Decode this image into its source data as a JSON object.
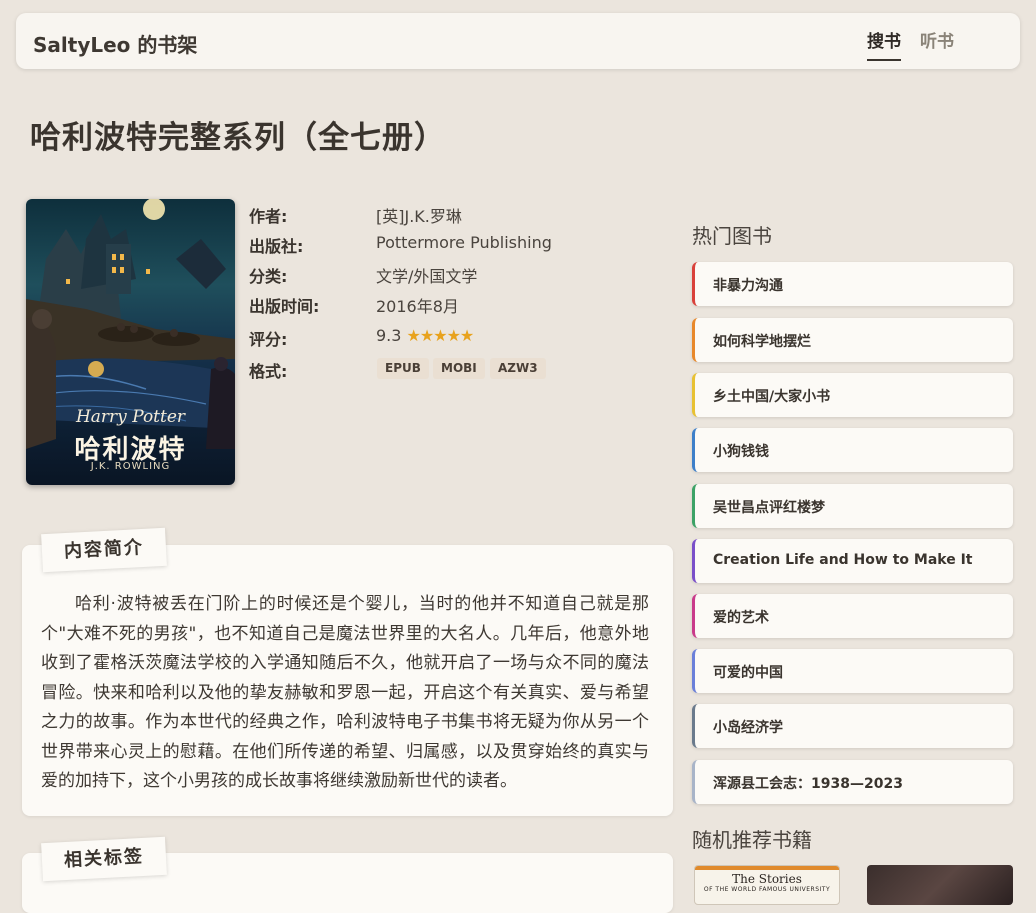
{
  "header": {
    "site_title": "SaltyLeo 的书架",
    "nav": [
      {
        "label": "搜书",
        "active": true
      },
      {
        "label": "听书",
        "active": false
      }
    ]
  },
  "book": {
    "title": "哈利波特完整系列（全七册）",
    "cover": {
      "brand": "Harry Potter",
      "cn_title": "哈利波特",
      "author": "J.K. ROWLING"
    },
    "meta": [
      {
        "label": "作者:",
        "value": "[英]J.K.罗琳"
      },
      {
        "label": "出版社:",
        "value": "Pottermore Publishing"
      },
      {
        "label": "分类:",
        "value": "文学/外国文学"
      },
      {
        "label": "出版时间:",
        "value": "2016年8月"
      },
      {
        "label": "评分:",
        "value": "9.3"
      },
      {
        "label": "格式:",
        "value": ""
      }
    ],
    "rating_stars": "★★★★★",
    "formats": [
      "EPUB",
      "MOBI",
      "AZW3"
    ]
  },
  "intro": {
    "heading": "内容简介",
    "text": "哈利·波特被丢在门阶上的时候还是个婴儿，当时的他并不知道自己就是那个\"大难不死的男孩\"，也不知道自己是魔法世界里的大名人。几年后，他意外地收到了霍格沃茨魔法学校的入学通知随后不久，他就开启了一场与众不同的魔法冒险。快来和哈利以及他的挚友赫敏和罗恩一起，开启这个有关真实、爱与希望之力的故事。作为本世代的经典之作，哈利波特电子书集书将无疑为你从另一个世界带来心灵上的慰藉。在他们所传递的希望、归属感，以及贯穿始终的真实与爱的加持下，这个小男孩的成长故事将继续激励新世代的读者。"
  },
  "tags": {
    "heading": "相关标签"
  },
  "sidebar": {
    "hot_heading": "热门图书",
    "hot_books": [
      {
        "title": "非暴力沟通",
        "color": "#d9413a"
      },
      {
        "title": "如何科学地摆烂",
        "color": "#e8882a"
      },
      {
        "title": "乡土中国/大家小书",
        "color": "#e8c132"
      },
      {
        "title": "小狗钱钱",
        "color": "#3d7fc9"
      },
      {
        "title": "吴世昌点评红楼梦",
        "color": "#3ca266"
      },
      {
        "title": "Creation Life and How to Make It",
        "color": "#7a4fc9"
      },
      {
        "title": "爱的艺术",
        "color": "#c93a8a"
      },
      {
        "title": "可爱的中国",
        "color": "#6a7fd9"
      },
      {
        "title": "小岛经济学",
        "color": "#6a7a8c"
      },
      {
        "title": "浑源县工会志：1938—2023",
        "color": "#a8b4c8"
      }
    ],
    "random_heading": "随机推荐书籍",
    "random_books": [
      {
        "title": "The Stories",
        "subtitle": "OF THE WORLD FAMOUS UNIVERSITY"
      },
      {
        "title": ""
      }
    ]
  }
}
